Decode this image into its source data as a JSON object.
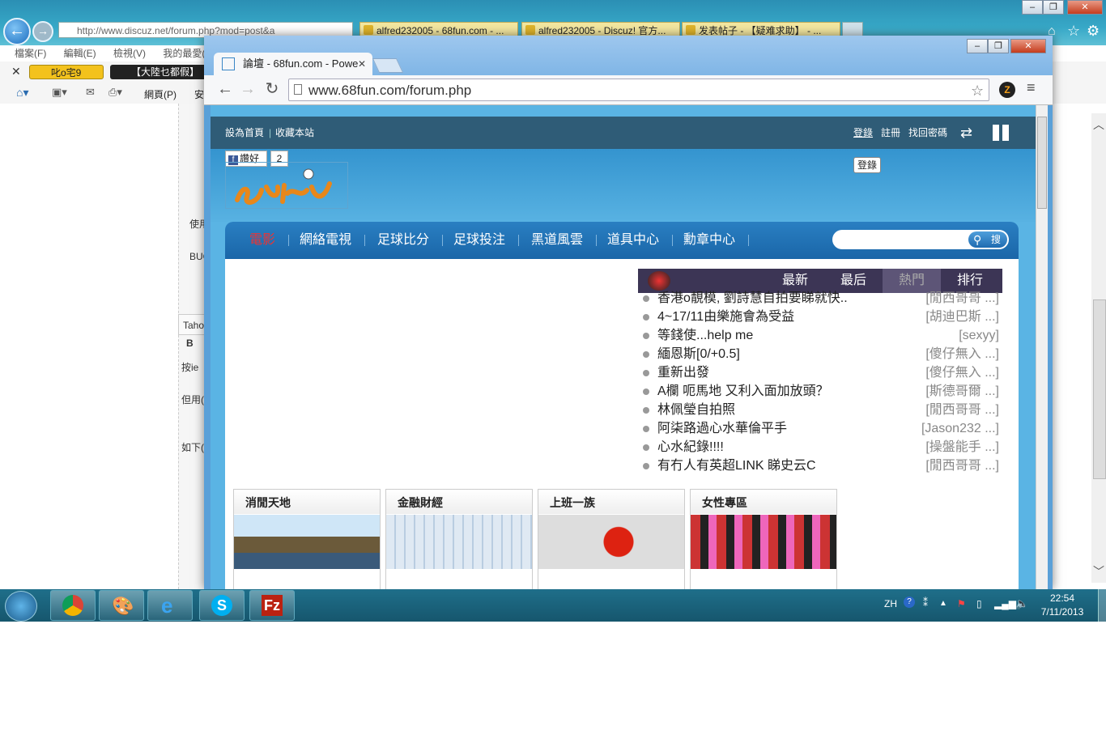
{
  "ie": {
    "address": "http://www.discuz.net/forum.php?mod=post&a",
    "tabs": [
      "alfred232005 - 68fun.com - ...",
      "alfred232005 - Discuz! 官方...",
      "发表帖子 - 【疑难求助】 - ..."
    ],
    "menu": [
      "檔案(F)",
      "編輯(E)",
      "檢視(V)",
      "我的最愛(A)"
    ],
    "fav_items": [
      "叱o宅9",
      "【大陸乜都假】"
    ],
    "cmd_items": [
      "網頁(P)",
      "安"
    ],
    "left_texts": [
      "使用",
      "BUG",
      "Taho",
      "B",
      "按ie",
      "但用(",
      "如下("
    ]
  },
  "chrome": {
    "tab_title": "論壇 - 68fun.com - Powe",
    "url": "www.68fun.com/forum.php"
  },
  "page": {
    "toplinks": {
      "home": "設為首頁",
      "sep": "|",
      "bookmark": "收藏本站"
    },
    "login_links": [
      "登錄",
      "註冊",
      "找回密碼"
    ],
    "tooltip": "登錄",
    "fb": {
      "like": "讚好",
      "count": "2"
    },
    "nav": [
      "電影",
      "網絡電視",
      "足球比分",
      "足球投注",
      "黑道風雲",
      "道具中心",
      "勳章中心"
    ],
    "search_btn": "搜",
    "hot_tabs": [
      "最新",
      "最后",
      "熱門",
      "排行"
    ],
    "threads": [
      {
        "title": "香港o靚模, 劉詩慧自拍要睇就快..",
        "author": "[閒西哥哥 ...]"
      },
      {
        "title": "4~17/11由樂施會為受益",
        "author": "[胡迪巴斯 ...]"
      },
      {
        "title": "等錢使...help me",
        "author": "[sexyy]"
      },
      {
        "title": "緬恩斯[0/+0.5]",
        "author": "[傻仔無入 ...]"
      },
      {
        "title": "重新出發",
        "author": "[傻仔無入 ...]"
      },
      {
        "title": "A欄 呃馬地 又利入面加放頭？",
        "author": "[斯德哥爾 ...]"
      },
      {
        "title": "林佩瑩自拍照",
        "author": "[閒西哥哥 ...]"
      },
      {
        "title": "阿柒路過心水華倫平手",
        "author": "[Jason232 ...]"
      },
      {
        "title": "心水紀錄!!!!",
        "author": "[操盤能手 ...]"
      },
      {
        "title": "有冇人有英超LINK 睇史云C",
        "author": "[閒西哥哥 ...]"
      }
    ],
    "cards": [
      "消閒天地",
      "金融財經",
      "上班一族",
      "女性專區"
    ]
  },
  "taskbar": {
    "lang": "ZH",
    "time": "22:54",
    "date": "7/11/2013"
  }
}
